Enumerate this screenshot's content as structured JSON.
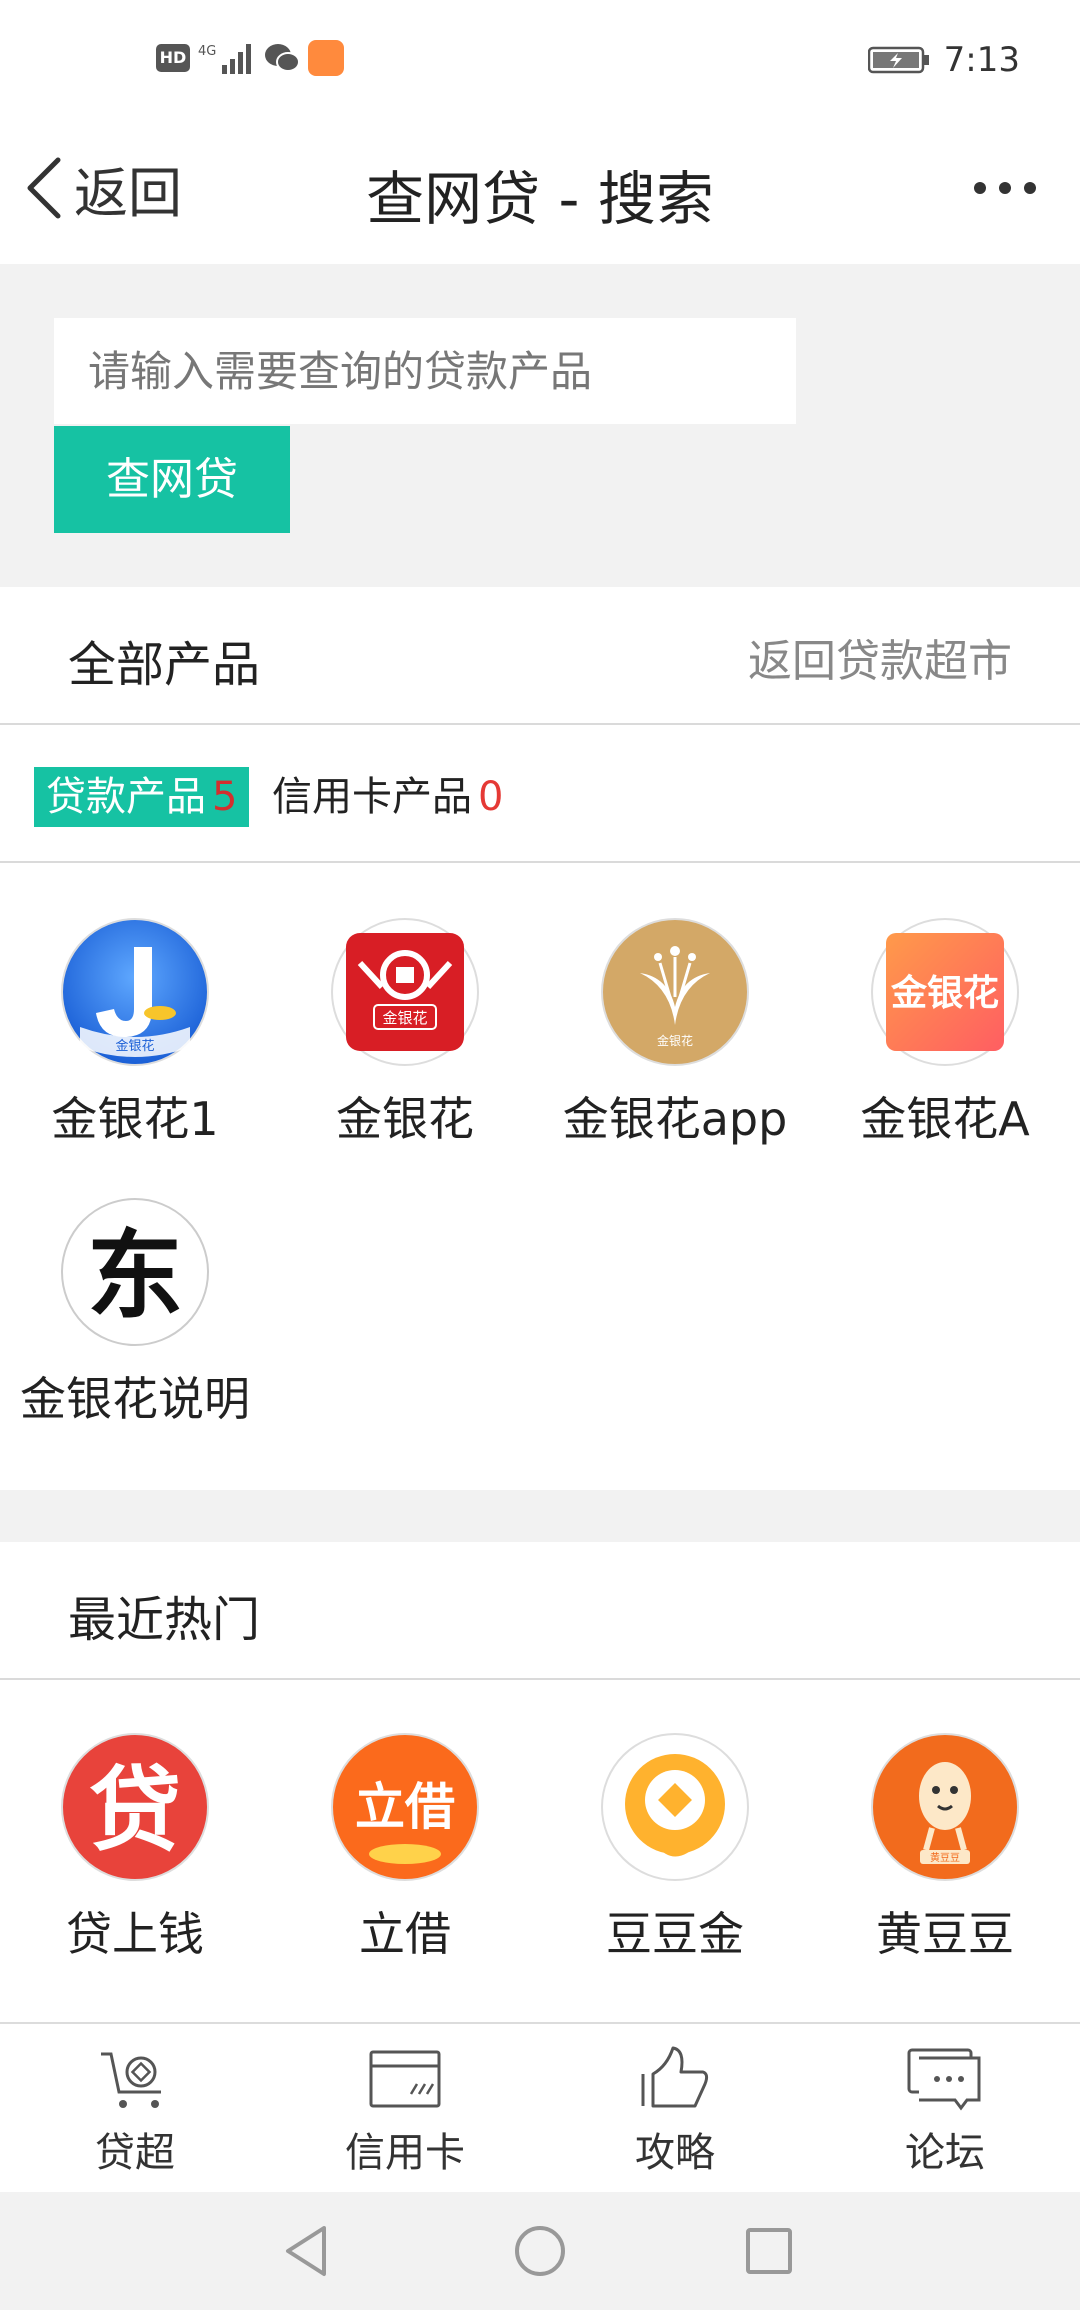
{
  "status_bar": {
    "network": "4G",
    "hd": "HD",
    "time": "7:13"
  },
  "nav": {
    "back_label": "返回",
    "title": "查网贷 - 搜索"
  },
  "search": {
    "placeholder": "请输入需要查询的贷款产品",
    "value": "",
    "button_label": "查网贷"
  },
  "products": {
    "title": "全部产品",
    "link": "返回贷款超市",
    "tabs": [
      {
        "label": "贷款产品",
        "count": "5"
      },
      {
        "label": "信用卡产品",
        "count": "0"
      }
    ],
    "items": [
      {
        "label": "金银花1",
        "icon": "jinyinhua-j-logo",
        "logo_text": "金银花"
      },
      {
        "label": "金银花",
        "icon": "jinyinhua-red-logo",
        "logo_text": "金银花"
      },
      {
        "label": "金银花app",
        "icon": "jinyinhua-gold-logo",
        "logo_text": "金银花"
      },
      {
        "label": "金银花A",
        "icon": "jinyinhua-orange-logo",
        "logo_text": "金银花"
      },
      {
        "label": "金银花说明",
        "icon": "dong-logo",
        "logo_text": "东"
      }
    ]
  },
  "hot": {
    "title": "最近热门",
    "items": [
      {
        "label": "贷上钱",
        "icon": "daishangqian-logo",
        "logo_text": "贷"
      },
      {
        "label": "立借",
        "icon": "lijie-logo",
        "logo_text": "立借"
      },
      {
        "label": "豆豆金",
        "icon": "doudoujin-logo"
      },
      {
        "label": "黄豆豆",
        "icon": "huangdoudou-logo",
        "logo_text": "黄豆豆"
      }
    ]
  },
  "tab_bar": [
    {
      "label": "贷超",
      "icon": "cart-icon"
    },
    {
      "label": "信用卡",
      "icon": "credit-card-icon"
    },
    {
      "label": "攻略",
      "icon": "thumbs-up-icon"
    },
    {
      "label": "论坛",
      "icon": "forum-icon"
    }
  ],
  "colors": {
    "accent": "#16c2a3",
    "count": "#e53935"
  }
}
